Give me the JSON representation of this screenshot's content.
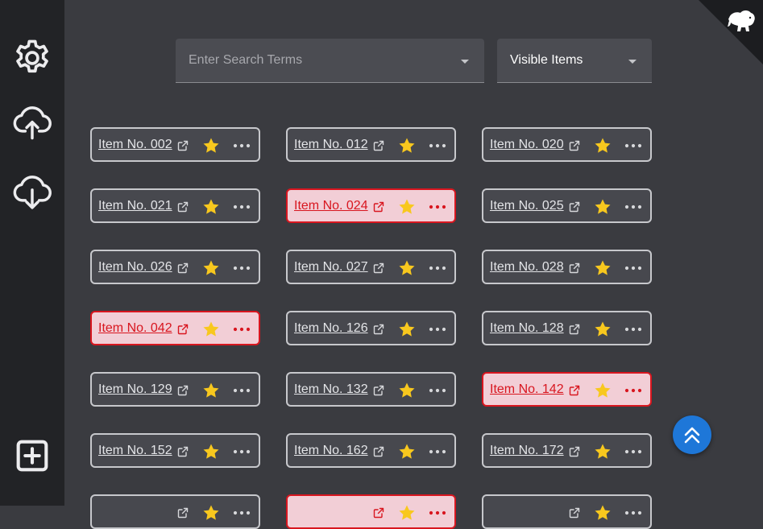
{
  "sidebar": {
    "settings_icon": "gear-icon",
    "upload_icon": "cloud-upload-icon",
    "download_icon": "cloud-download-icon",
    "add_icon": "plus-square-icon"
  },
  "search": {
    "placeholder": "Enter Search Terms"
  },
  "filter": {
    "value": "Visible Items"
  },
  "corner_icon": "elephant-icon",
  "colors": {
    "background": "#3a3b40",
    "sidebar": "#222326",
    "card_border": "#c7c8cc",
    "highlight_border": "#d8161f",
    "highlight_fill": "#f2ced6",
    "star": "#f8c81e",
    "fab": "#1e77d8"
  },
  "items": [
    {
      "label": "Item No. 002",
      "highlighted": false
    },
    {
      "label": "Item No. 012",
      "highlighted": false
    },
    {
      "label": "Item No. 020",
      "highlighted": false
    },
    {
      "label": "Item No. 021",
      "highlighted": false
    },
    {
      "label": "Item No. 024",
      "highlighted": true
    },
    {
      "label": "Item No. 025",
      "highlighted": false
    },
    {
      "label": "Item No. 026",
      "highlighted": false
    },
    {
      "label": "Item No. 027",
      "highlighted": false
    },
    {
      "label": "Item No. 028",
      "highlighted": false
    },
    {
      "label": "Item No. 042",
      "highlighted": true
    },
    {
      "label": "Item No. 126",
      "highlighted": false
    },
    {
      "label": "Item No. 128",
      "highlighted": false
    },
    {
      "label": "Item No. 129",
      "highlighted": false
    },
    {
      "label": "Item No. 132",
      "highlighted": false
    },
    {
      "label": "Item No. 142",
      "highlighted": true
    },
    {
      "label": "Item No. 152",
      "highlighted": false
    },
    {
      "label": "Item No. 162",
      "highlighted": false
    },
    {
      "label": "Item No. 172",
      "highlighted": false
    },
    {
      "label": "",
      "highlighted": false
    },
    {
      "label": "",
      "highlighted": true
    },
    {
      "label": "",
      "highlighted": false
    }
  ],
  "fab_icon": "double-chevron-up-icon"
}
